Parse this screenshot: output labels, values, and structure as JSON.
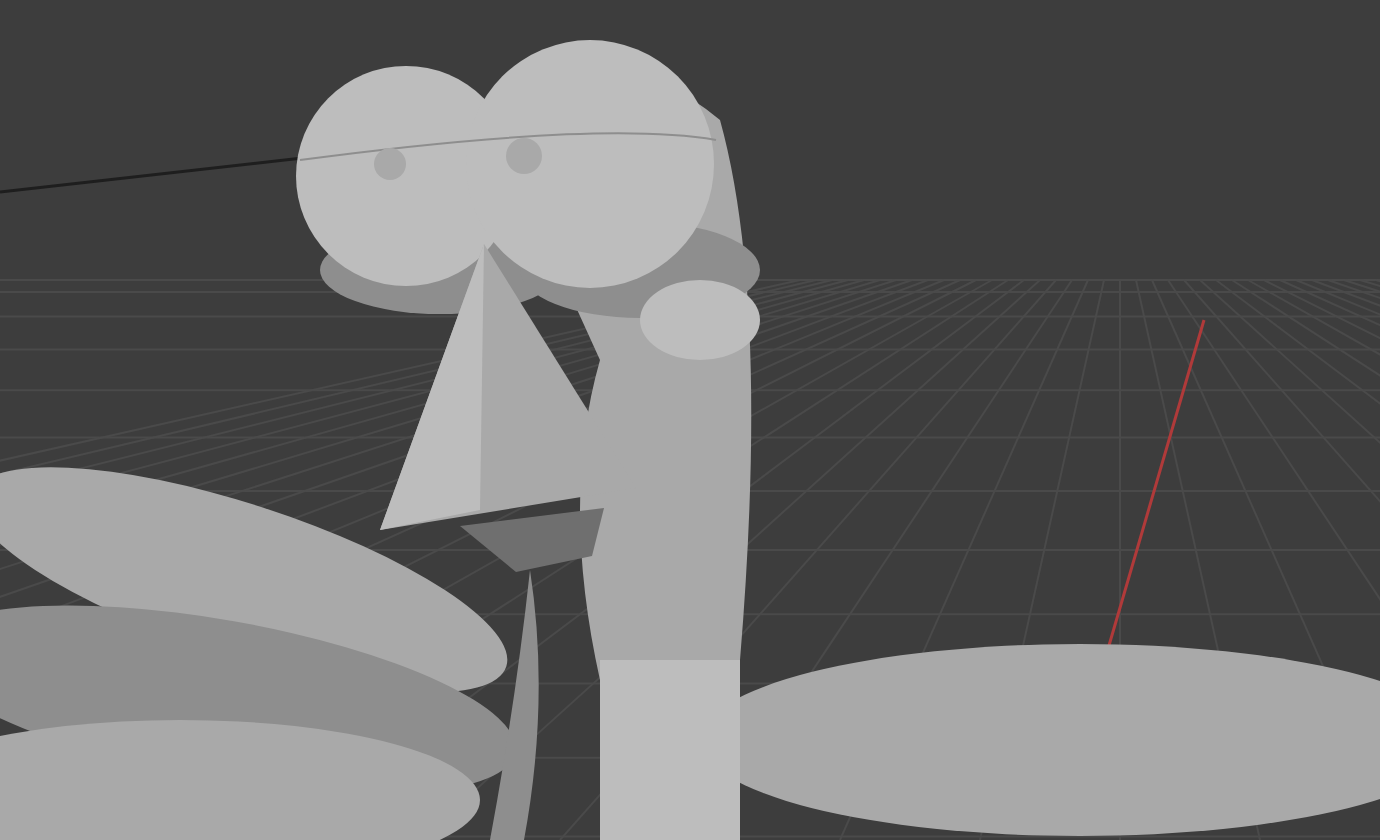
{
  "viewport": {
    "kind": "model"
  }
}
